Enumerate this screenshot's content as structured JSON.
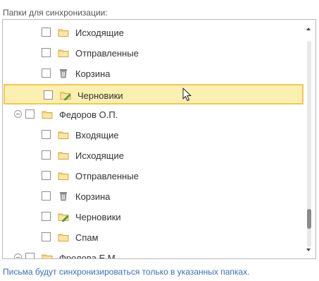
{
  "title": "Папки для синхронизации:",
  "rows": [
    {
      "level": 2,
      "label": "Исходящие",
      "icon": "folder-icon"
    },
    {
      "level": 2,
      "label": "Отправленные",
      "icon": "folder-icon"
    },
    {
      "level": 2,
      "label": "Корзина",
      "icon": "trash-icon"
    },
    {
      "level": 2,
      "label": "Черновики",
      "icon": "drafts-folder-icon",
      "selected": true
    },
    {
      "level": 1,
      "label": "Федоров О.П.",
      "icon": "folder-icon",
      "expanded": true
    },
    {
      "level": 2,
      "label": "Входящие",
      "icon": "folder-icon"
    },
    {
      "level": 2,
      "label": "Исходящие",
      "icon": "folder-icon"
    },
    {
      "level": 2,
      "label": "Отправленные",
      "icon": "folder-icon"
    },
    {
      "level": 2,
      "label": "Корзина",
      "icon": "trash-icon"
    },
    {
      "level": 2,
      "label": "Черновики",
      "icon": "drafts-folder-icon"
    },
    {
      "level": 2,
      "label": "Спам",
      "icon": "folder-icon"
    },
    {
      "level": 1,
      "label": "Фролова Е.М.",
      "icon": "folder-icon",
      "expanded": true
    }
  ],
  "footer_note": "Письма будут синхронизироваться только в указанных папках.",
  "colors": {
    "selection_bg": "#fbefb1",
    "selection_border": "#f2c94c",
    "folder": "#f3d27a",
    "link_text": "#3b6fb6"
  }
}
